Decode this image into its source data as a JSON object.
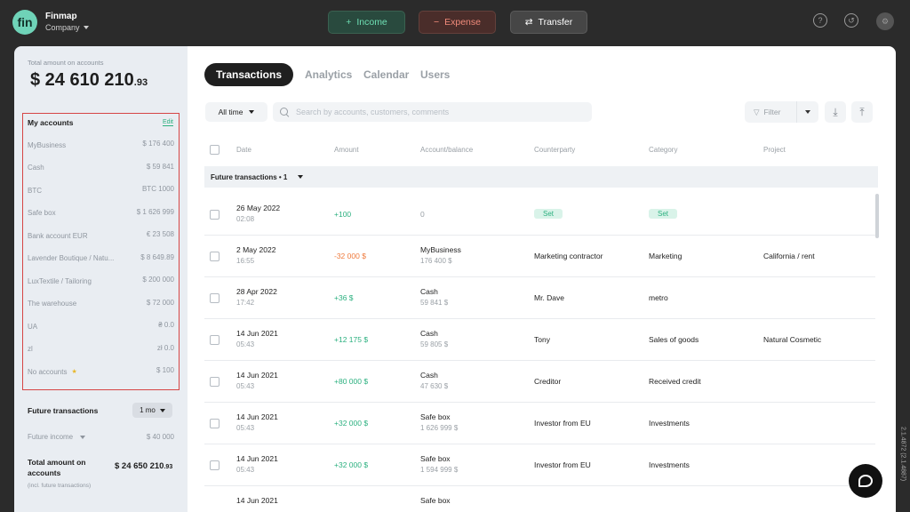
{
  "app": {
    "logo": "fin",
    "name": "Finmap",
    "company": "Company"
  },
  "topbar": {
    "income": "Income",
    "expense": "Expense",
    "transfer": "Transfer"
  },
  "sidebar": {
    "total_label": "Total amount on accounts",
    "total_value": "$ 24 610 210",
    "total_cents": ".93",
    "accounts_title": "My accounts",
    "edit_label": "Edit",
    "accounts": [
      {
        "name": "MyBusiness",
        "value": "$ 176 400"
      },
      {
        "name": "Cash",
        "value": "$ 59 841"
      },
      {
        "name": "BTC",
        "value": "BTC 1000"
      },
      {
        "name": "Safe box",
        "value": "$ 1 626 999"
      },
      {
        "name": "Bank account EUR",
        "value": "€ 23 508"
      },
      {
        "name": "Lavender Boutique / Natu...",
        "value": "$ 8 649.89"
      },
      {
        "name": "LuxTextile / Tailoring",
        "value": "$ 200 000"
      },
      {
        "name": "The warehouse",
        "value": "$ 72 000"
      },
      {
        "name": "UA",
        "value": "₴ 0.0"
      },
      {
        "name": "zl",
        "value": "zł 0.0"
      },
      {
        "name": "No accounts",
        "value": "$ 100"
      }
    ],
    "future_title": "Future transactions",
    "period": "1 mo",
    "future_income_label": "Future income",
    "future_income_value": "$ 40 000",
    "acc_total_label": "Total amount on accounts",
    "acc_total_value": "$ 24 650 210",
    "acc_total_cents": ".93",
    "acc_total_note": "(incl. future transactions)"
  },
  "main": {
    "tabs": [
      "Transactions",
      "Analytics",
      "Calendar",
      "Users"
    ],
    "period_select": "All time",
    "search_placeholder": "Search by accounts, customers, comments",
    "filter_label": "Filter",
    "columns": [
      "Date",
      "Amount",
      "Account/balance",
      "Counterparty",
      "Category",
      "Project"
    ],
    "group_label": "Future transactions • 1",
    "rows": [
      {
        "date": "26 May 2022",
        "time": "02:08",
        "amount": "+100",
        "amount_type": "pos",
        "account": "0",
        "account_balance": "",
        "counterparty": "Set",
        "category": "Set",
        "project": "",
        "tags": true
      },
      {
        "date": "2 May 2022",
        "time": "16:55",
        "amount": "-32 000  $",
        "amount_type": "neg",
        "account": "MyBusiness",
        "account_balance": "176 400  $",
        "counterparty": "Marketing contractor",
        "category": "Marketing",
        "project": "California / rent"
      },
      {
        "date": "28 Apr 2022",
        "time": "17:42",
        "amount": "+36  $",
        "amount_type": "pos",
        "account": "Cash",
        "account_balance": "59 841  $",
        "counterparty": "Mr. Dave",
        "category": "metro",
        "project": ""
      },
      {
        "date": "14 Jun 2021",
        "time": "05:43",
        "amount": "+12 175  $",
        "amount_type": "pos",
        "account": "Cash",
        "account_balance": "59 805  $",
        "counterparty": "Tony",
        "category": "Sales of goods",
        "project": "Natural Cosmetic"
      },
      {
        "date": "14 Jun 2021",
        "time": "05:43",
        "amount": "+80 000  $",
        "amount_type": "pos",
        "account": "Cash",
        "account_balance": "47 630  $",
        "counterparty": "Creditor",
        "category": "Received credit",
        "project": ""
      },
      {
        "date": "14 Jun 2021",
        "time": "05:43",
        "amount": "+32 000  $",
        "amount_type": "pos",
        "account": "Safe box",
        "account_balance": "1 626 999  $",
        "counterparty": "Investor from EU",
        "category": "Investments",
        "project": ""
      },
      {
        "date": "14 Jun 2021",
        "time": "05:43",
        "amount": "+32 000  $",
        "amount_type": "pos",
        "account": "Safe box",
        "account_balance": "1 594 999  $",
        "counterparty": "Investor from EU",
        "category": "Investments",
        "project": ""
      },
      {
        "date": "14 Jun 2021",
        "time": "",
        "amount": "",
        "amount_type": "pos",
        "account": "Safe box",
        "account_balance": "",
        "counterparty": "",
        "category": "",
        "project": ""
      }
    ]
  },
  "version": "2.1.4872 (2.1.4887)",
  "colors": {
    "accent_green": "#2bb07f",
    "negative_orange": "#ef7a3c",
    "highlight_red": "#d64545"
  }
}
